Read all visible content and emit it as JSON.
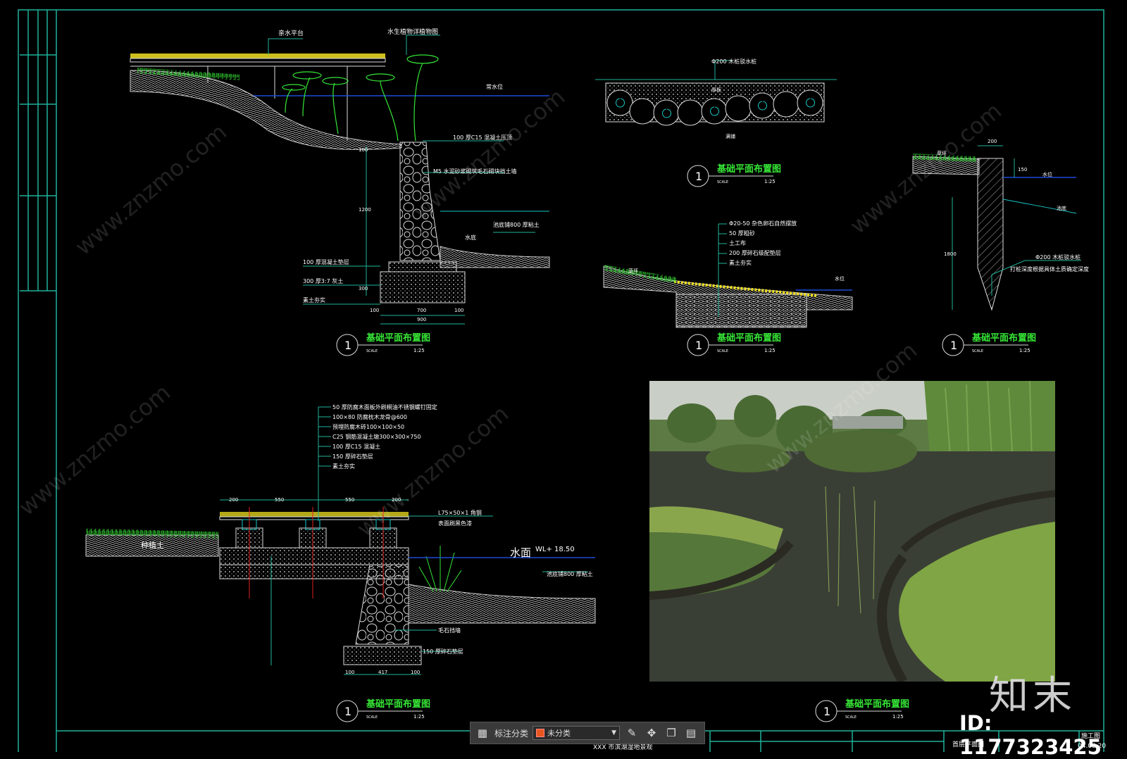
{
  "drawing": {
    "section1": {
      "label_top1": "亲水平台",
      "label_top2": "水生植物详植物图",
      "label_water": "常水位",
      "label_a": "100 厚C15 混凝土压顶",
      "label_b": "M5 水泥砂浆砌筑毛石砌块挡土墙",
      "label_c": "池底铺800 厚粘土",
      "label_d": "水底",
      "label_e": "100 厚混凝土垫层",
      "label_f": "300 厚3:7 灰土",
      "label_g": "素土夯实",
      "dim_1": "100",
      "dim_2": "1200",
      "dim_3": "300",
      "dim_4": "100",
      "dim_5": "700",
      "dim_6": "100",
      "dim_7": "900"
    },
    "section2": {
      "label_top": "Φ200 木桩驳水桩",
      "label_mid": "厚板",
      "label_bottom": "满铺"
    },
    "section3": {
      "label_1": "Φ20-50 杂色卵石自然摆放",
      "label_2": "50 厚粗砂",
      "label_3": "土工布",
      "label_4": "200 厚碎石级配垫层",
      "label_5": "素土夯实",
      "label_grass": "草坪",
      "label_water": "水位"
    },
    "section4": {
      "dim_top": "200",
      "dim_side": "150",
      "dim_tall": "1800",
      "label_grass": "草坪",
      "label_water": "水位",
      "label_bed": "池底",
      "label_pile1": "Φ200 木桩驳水桩",
      "label_pile2": "打桩深度根据具体土质确定深度"
    },
    "section5": {
      "label_1": "50 厚防腐木面板外刷桐油不锈钢螺钉固定",
      "label_2": "100×80 防腐枕木龙骨@600",
      "label_3": "预埋防腐木砖100×100×50",
      "label_4": "C25 钢筋混凝土墩300×300×750",
      "label_5": "100 厚C15 混凝土",
      "label_6": "150 厚碎石垫层",
      "label_7": "素土夯实",
      "label_soil": "种植土",
      "label_angle": "L75×50×1  角钢",
      "label_paint": "表面刷黑色漆",
      "label_water": "水面",
      "label_wl": "WL+ 18.50",
      "label_bed": "池底铺800 厚粘土",
      "label_wall": "毛石挡墙",
      "label_base": "150 厚碎石垫层",
      "dim_a": "200",
      "dim_b": "550",
      "dim_c": "550",
      "dim_d": "200",
      "dim_e": "100",
      "dim_f": "417",
      "dim_g": "100"
    },
    "titles": [
      {
        "num": "1",
        "text": "基础平面布置图",
        "scale_label": "SCALE",
        "scale": "1:25"
      },
      {
        "num": "1",
        "text": "基础平面布置图",
        "scale_label": "SCALE",
        "scale": "1:25"
      },
      {
        "num": "1",
        "text": "基础平面布置图",
        "scale_label": "SCALE",
        "scale": "1:25"
      },
      {
        "num": "1",
        "text": "基础平面布置图",
        "scale_label": "SCALE",
        "scale": "1:25"
      },
      {
        "num": "1",
        "text": "基础平面布置图",
        "scale_label": "SCALE",
        "scale": "1:25"
      },
      {
        "num": "1",
        "text": "基础平面布置图",
        "scale_label": "SCALE",
        "scale": "1:25"
      }
    ],
    "titleblock": {
      "project": "XXX 市滨湖湿地景观",
      "drawing_name": "首层平面图",
      "stage": "施工图",
      "date": "04.08.20"
    }
  },
  "toolbar": {
    "label": "标注分类",
    "selected": "未分类",
    "icons": [
      "grid-icon",
      "edit-icon",
      "move-icon",
      "copy-icon",
      "paste-icon"
    ],
    "swatch_color": "#e8561f"
  },
  "brand": "知末",
  "id_text": "ID: 1177323425",
  "watermark": "www.znzmo.com",
  "colors": {
    "frame": "#1fb39a",
    "green": "#36e636",
    "yellow": "#f0e020",
    "cyan": "#19c8c8",
    "white": "#ffffff"
  }
}
